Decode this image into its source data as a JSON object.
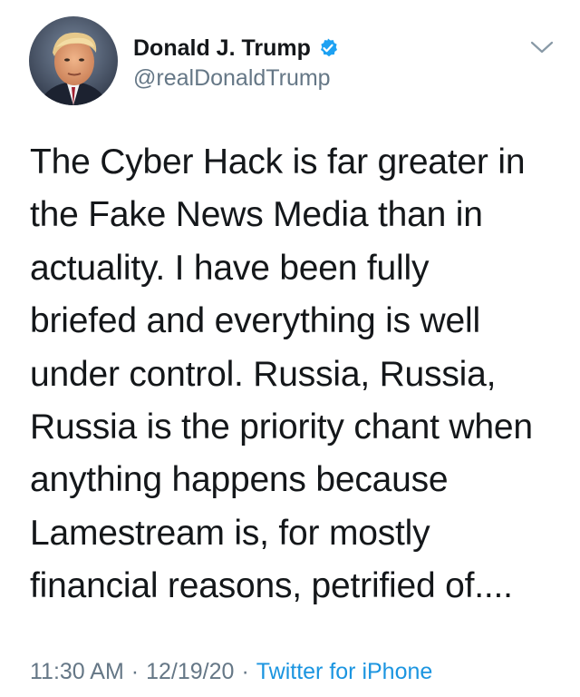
{
  "author": {
    "display_name": "Donald J. Trump",
    "handle": "@realDonaldTrump",
    "verified": true,
    "avatar_icon": "profile-photo"
  },
  "tweet": {
    "lines": [
      "The Cyber Hack is far greater in",
      "the Fake News Media than in",
      "actuality. I have been fully",
      "briefed and everything is well",
      "under control. Russia, Russia,",
      "Russia is the priority chant when",
      "anything happens because",
      "Lamestream is, for mostly",
      "financial reasons, petrified of...."
    ]
  },
  "meta": {
    "time": "11:30 AM",
    "separator": "·",
    "date": "12/19/20",
    "source": "Twitter for iPhone"
  },
  "icons": {
    "verified": "verified-badge-icon",
    "menu": "chevron-down-icon"
  },
  "colors": {
    "text": "#14171a",
    "secondary": "#657786",
    "link": "#1b95e0",
    "verified": "#1da1f2"
  }
}
